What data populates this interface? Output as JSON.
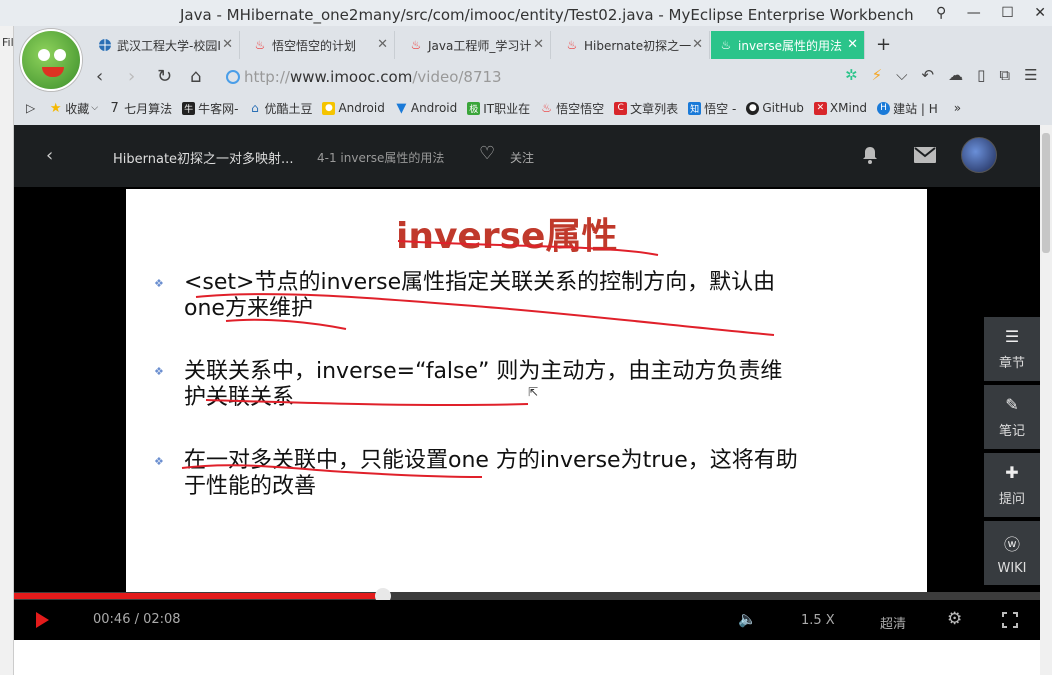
{
  "ide": {
    "title": "Java - MHibernate_one2many/src/com/imooc/entity/Test02.java - MyEclipse Enterprise Workbench",
    "left_label": "Fil",
    "controls": [
      "⚲",
      "—",
      "☐",
      "✕"
    ]
  },
  "browser": {
    "tabs": [
      {
        "label": "武汉工程大学-校园I",
        "icon": "globe"
      },
      {
        "label": "悟空悟空的计划",
        "icon": "flame"
      },
      {
        "label": "Java工程师_学习计",
        "icon": "flame"
      },
      {
        "label": "Hibernate初探之一",
        "icon": "flame"
      },
      {
        "label": "inverse属性的用法",
        "icon": "flame",
        "active": true
      }
    ],
    "new_tab": "+",
    "url_prefix": "http://",
    "url_domain": "www.imooc.com",
    "url_path": "/video/8713",
    "bookmarks": [
      {
        "label": "收藏",
        "icon": "star"
      },
      {
        "label": "七月算法",
        "icon": "seven"
      },
      {
        "label": "牛客网-",
        "icon": "nk"
      },
      {
        "label": "优酷土豆",
        "icon": "yk"
      },
      {
        "label": "Android",
        "icon": "bee"
      },
      {
        "label": "Android",
        "icon": "funnel"
      },
      {
        "label": "IT职业在",
        "icon": "jk"
      },
      {
        "label": "悟空悟空",
        "icon": "flame"
      },
      {
        "label": "文章列表",
        "icon": "csdn"
      },
      {
        "label": "悟空 -",
        "icon": "zhi"
      },
      {
        "label": "GitHub",
        "icon": "github"
      },
      {
        "label": "XMind",
        "icon": "xmind"
      },
      {
        "label": "建站 | H",
        "icon": "h"
      }
    ]
  },
  "video_header": {
    "back": "‹",
    "course_title": "Hibernate初探之一对多映射...",
    "lesson_title": "4-1 inverse属性的用法",
    "follow": "关注"
  },
  "slide": {
    "title": "inverse属性",
    "bullets": [
      {
        "line1": "<set>节点的inverse属性指定关联关系的控制方向，默认由",
        "line2": "one方来维护"
      },
      {
        "line1": "关联关系中，inverse=“false” 则为主动方，由主动方负责维",
        "line2": "护关联关系"
      },
      {
        "line1": "在一对多关联中，只能设置one 方的inverse为true，这将有助",
        "line2": "于性能的改善"
      }
    ]
  },
  "sidebar": [
    {
      "label": "章节",
      "icon": "menu-icon"
    },
    {
      "label": "笔记",
      "icon": "pencil-icon"
    },
    {
      "label": "提问",
      "icon": "question-icon"
    },
    {
      "label": "WIKI",
      "icon": "wiki-icon"
    }
  ],
  "player": {
    "current_time": "00:46",
    "duration": "02:08",
    "time_display": "00:46 / 02:08",
    "progress": 0.36,
    "speed": "1.5 X",
    "quality": "超清"
  },
  "colors": {
    "accent": "#2bc48a",
    "progress": "#e31b1b",
    "slide_title": "#c0392b",
    "annotation": "#e0202a"
  }
}
